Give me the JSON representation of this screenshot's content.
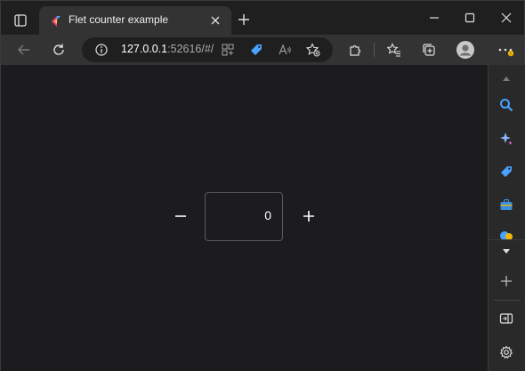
{
  "browser": {
    "tab_title": "Flet counter example",
    "url_host": "127.0.0.1",
    "url_rest": ":52616/#/"
  },
  "counter": {
    "value": "0",
    "minus_label": "−",
    "plus_label": "+"
  },
  "icons": {
    "tab_actions": "tab-actions-icon",
    "favicon": "flet-logo-icon",
    "close": "close-icon",
    "new_tab": "plus-icon",
    "minimize": "minimize-icon",
    "maximize": "maximize-icon",
    "window_close": "close-icon",
    "back": "back-arrow-icon",
    "refresh": "refresh-icon",
    "info": "info-icon",
    "apps": "apps-icon",
    "shopping": "tag-icon",
    "read_aloud": "read-aloud-icon",
    "favorite": "star-plus-icon",
    "extensions": "puzzle-icon",
    "favorites": "favorites-icon",
    "collections": "collections-icon",
    "profile": "avatar-icon",
    "more": "more-icon",
    "sidebar_up": "chevron-up-icon",
    "search": "search-icon",
    "copilot": "sparkle-icon",
    "shopping_sb": "tag-icon",
    "tools": "toolbox-icon",
    "games": "games-icon",
    "sidebar_down": "chevron-down-icon",
    "add": "plus-icon",
    "split": "split-screen-icon",
    "settings": "gear-icon"
  },
  "colors": {
    "accent_blue": "#4aa3ff",
    "page_bg": "#1c1c1e"
  }
}
